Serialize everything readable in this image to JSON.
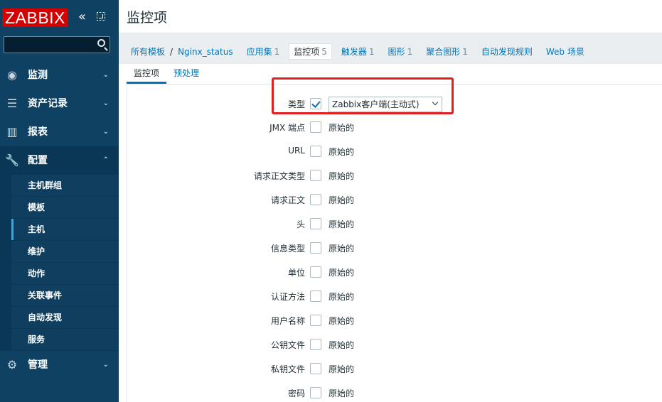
{
  "logo": "ZABBIX",
  "sidebar": {
    "collapse_glyph": "«",
    "menu": [
      {
        "label": "监测",
        "icon": "eye-icon",
        "glyph": "◉",
        "arrow": "⌄"
      },
      {
        "label": "资产记录",
        "icon": "list-icon",
        "glyph": "☰",
        "arrow": "⌄"
      },
      {
        "label": "报表",
        "icon": "bar-chart-icon",
        "glyph": "▥",
        "arrow": "⌄"
      },
      {
        "label": "配置",
        "icon": "wrench-icon",
        "glyph": "🔧",
        "arrow": "⌃"
      },
      {
        "label": "管理",
        "icon": "gear-icon",
        "glyph": "⚙",
        "arrow": "⌄"
      }
    ],
    "submenu": [
      "主机群组",
      "模板",
      "主机",
      "维护",
      "动作",
      "关联事件",
      "自动发现",
      "服务"
    ]
  },
  "page": {
    "title": "监控项"
  },
  "breadcrumb": {
    "root": "所有模板",
    "separator": "/",
    "host": "Nginx_status",
    "tabs": [
      {
        "label": "应用集",
        "count": "1"
      },
      {
        "label": "监控项",
        "count": "5"
      },
      {
        "label": "触发器",
        "count": "1"
      },
      {
        "label": "图形",
        "count": "1"
      },
      {
        "label": "聚合图形",
        "count": "1"
      },
      {
        "label": "自动发现规则",
        "count": ""
      },
      {
        "label": "Web 场景",
        "count": ""
      }
    ]
  },
  "subtabs": [
    "监控项",
    "预处理"
  ],
  "form": {
    "type_label": "类型",
    "type_value": "Zabbix客户端(主动式)",
    "original": "原始的",
    "fields": [
      "JMX 端点",
      "URL",
      "请求正文类型",
      "请求正文",
      "头",
      "信息类型",
      "单位",
      "认证方法",
      "用户名称",
      "公钥文件",
      "私钥文件",
      "密码"
    ]
  },
  "colors": {
    "sidebar": "#0f4162",
    "link": "#0275b8",
    "logo": "#d40000",
    "highlight": "#e02020"
  }
}
